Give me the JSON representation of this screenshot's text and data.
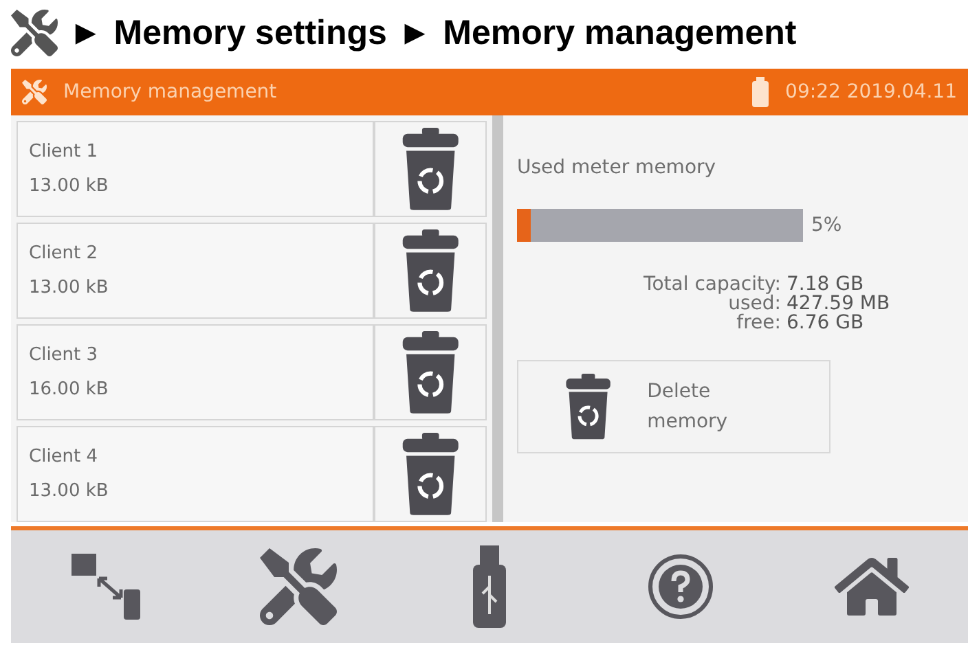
{
  "breadcrumb": {
    "separator": "►",
    "items": [
      "Memory settings",
      "Memory management"
    ]
  },
  "header": {
    "title": "Memory management",
    "time": "09:22 2019.04.11"
  },
  "clients": [
    {
      "name": "Client 1",
      "size": "13.00 kB"
    },
    {
      "name": "Client 2",
      "size": "13.00 kB"
    },
    {
      "name": "Client 3",
      "size": "16.00 kB"
    },
    {
      "name": "Client 4",
      "size": "13.00 kB"
    }
  ],
  "memory": {
    "label": "Used meter memory",
    "level": 0.05,
    "percent": "5%",
    "stats": [
      {
        "label": "Total capacity:",
        "value": "7.18 GB"
      },
      {
        "label": "used:",
        "value": "427.59 MB"
      },
      {
        "label": "free:",
        "value": "6.76 GB"
      }
    ],
    "delete_button": "Delete memory"
  }
}
